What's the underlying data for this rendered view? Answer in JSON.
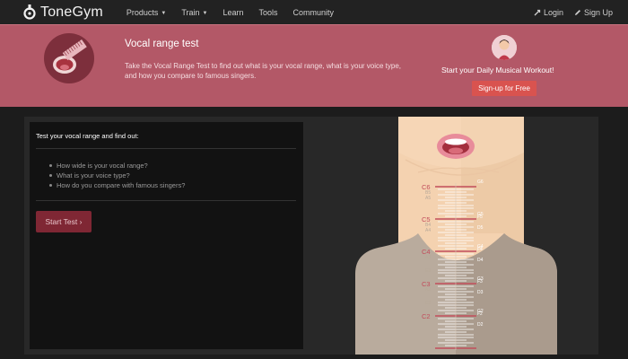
{
  "navbar": {
    "brand": "ToneGym",
    "items": [
      {
        "label": "Products",
        "caret": "▼"
      },
      {
        "label": "Train",
        "caret": "▼"
      },
      {
        "label": "Learn"
      },
      {
        "label": "Tools"
      },
      {
        "label": "Community"
      }
    ],
    "login": "Login",
    "signup": "Sign Up"
  },
  "banner": {
    "title": "Vocal range test",
    "description": "Take the Vocal Range Test to find out what is your vocal range, what is your voice type, and how you compare to famous singers.",
    "promo_text": "Start your Daily Musical Workout!",
    "promo_button": "Sign-up for Free"
  },
  "panel": {
    "title": "Test your vocal range and find out:",
    "items": [
      "How wide is your vocal range?",
      "What is your voice type?",
      "How do you compare with famous singers?"
    ],
    "start_button": "Start Test ›"
  },
  "range_chart": {
    "left_notes_major": [
      "C6",
      "C5",
      "C4",
      "C3",
      "C2"
    ],
    "left_notes_minor": [
      "B5",
      "A5",
      "B4",
      "A4",
      "A3",
      "E3",
      "A2",
      "E2"
    ],
    "right_notes": [
      "G6",
      "G5",
      "F5",
      "D5",
      "G4",
      "F4",
      "D4",
      "G3",
      "F3",
      "D3",
      "G2",
      "F2",
      "D2"
    ],
    "colors": {
      "major": "#c24e5c",
      "minor": "#e8d8c8",
      "skin": "#f4d2b0",
      "shirt": "#b9ab9d"
    }
  }
}
